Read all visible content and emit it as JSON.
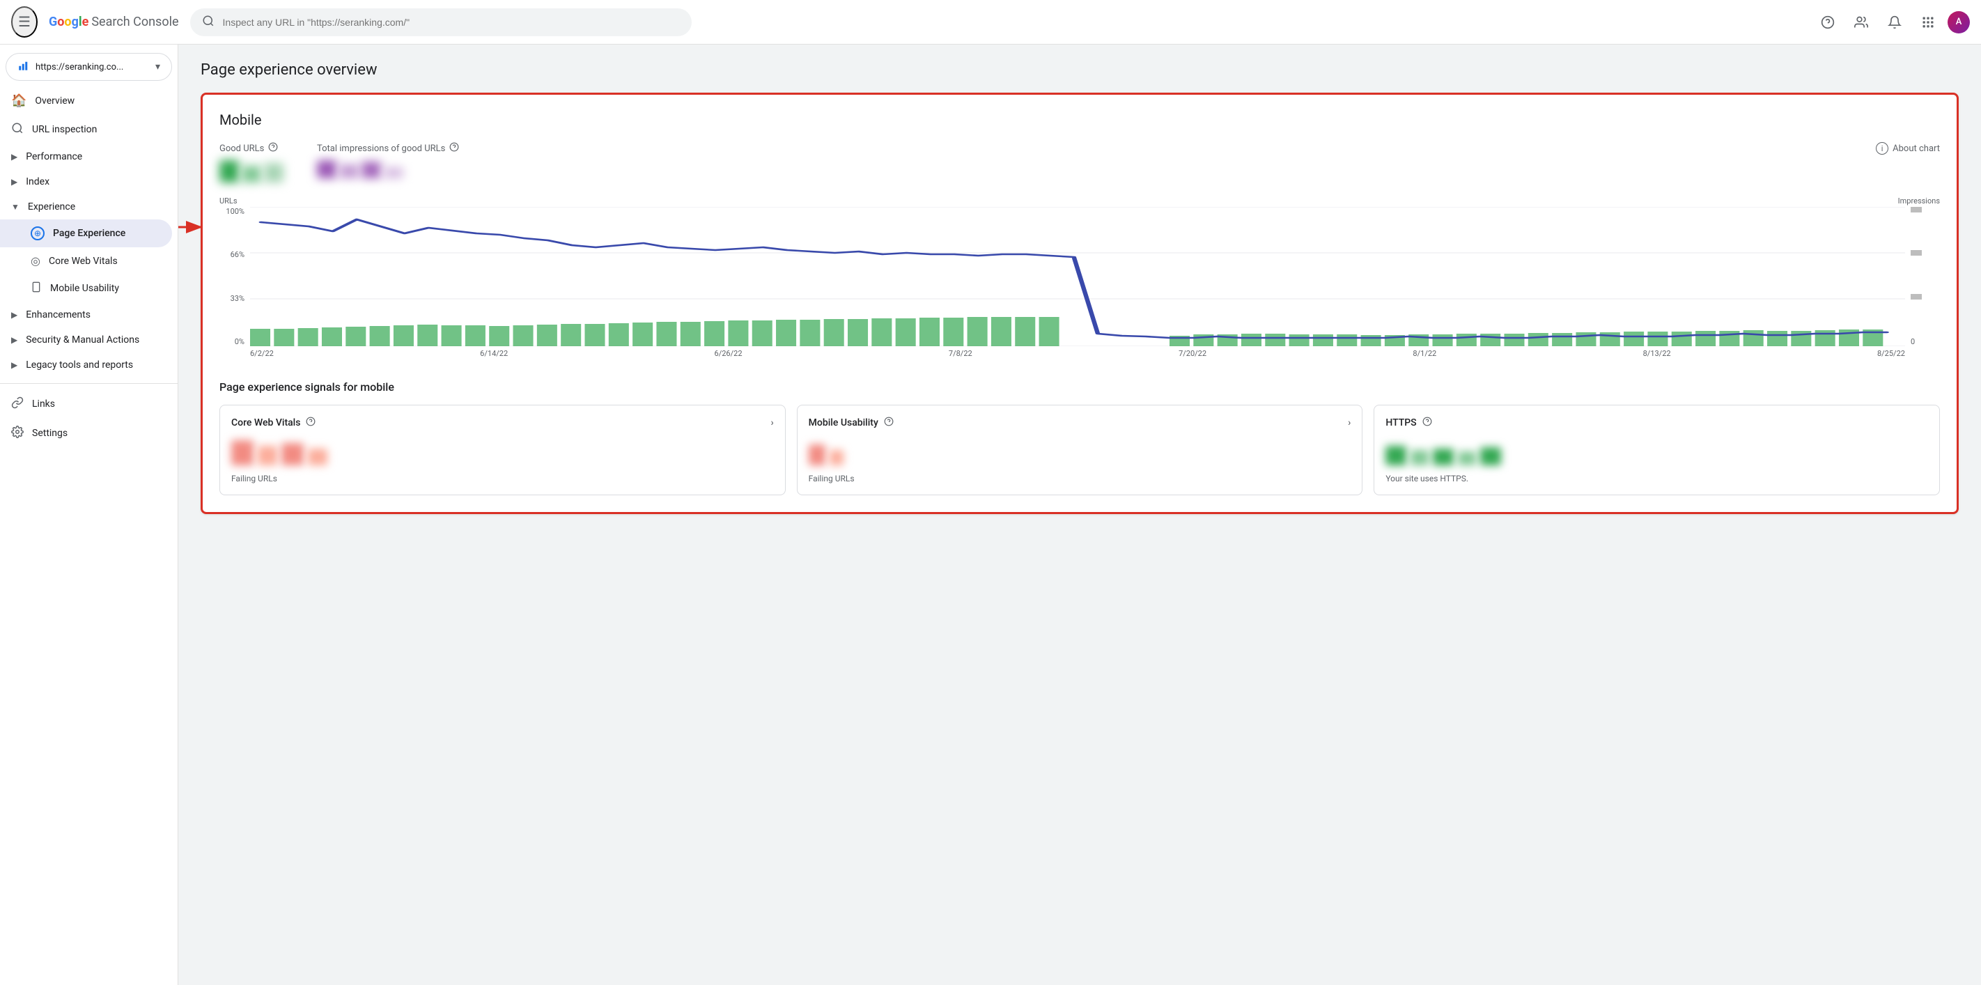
{
  "topbar": {
    "menu_label": "☰",
    "logo_letters": [
      "G",
      "o",
      "o",
      "g",
      "l",
      "e"
    ],
    "app_name": "Search Console",
    "search_placeholder": "Inspect any URL in \"https://seranking.com/\"",
    "help_icon": "?",
    "people_icon": "👤",
    "bell_icon": "🔔",
    "grid_icon": "⋮⋮⋮",
    "avatar_initial": "A"
  },
  "sidebar": {
    "site_name": "https://seranking.co...",
    "items": [
      {
        "id": "overview",
        "label": "Overview",
        "icon": "🏠",
        "type": "item"
      },
      {
        "id": "url-inspection",
        "label": "URL inspection",
        "icon": "🔍",
        "type": "item"
      },
      {
        "id": "performance",
        "label": "Performance",
        "icon": "",
        "type": "group",
        "expanded": false
      },
      {
        "id": "index",
        "label": "Index",
        "icon": "",
        "type": "group",
        "expanded": false
      },
      {
        "id": "experience",
        "label": "Experience",
        "icon": "",
        "type": "group",
        "expanded": true
      },
      {
        "id": "page-experience",
        "label": "Page Experience",
        "icon": "⊕",
        "type": "subitem",
        "active": true
      },
      {
        "id": "core-web-vitals",
        "label": "Core Web Vitals",
        "icon": "◎",
        "type": "subitem"
      },
      {
        "id": "mobile-usability",
        "label": "Mobile Usability",
        "icon": "📱",
        "type": "subitem"
      },
      {
        "id": "enhancements",
        "label": "Enhancements",
        "icon": "",
        "type": "group",
        "expanded": false
      },
      {
        "id": "security-manual",
        "label": "Security & Manual Actions",
        "icon": "",
        "type": "group",
        "expanded": false
      },
      {
        "id": "legacy-tools",
        "label": "Legacy tools and reports",
        "icon": "",
        "type": "group",
        "expanded": false
      },
      {
        "id": "links",
        "label": "Links",
        "icon": "🔗",
        "type": "item"
      },
      {
        "id": "settings",
        "label": "Settings",
        "icon": "⚙",
        "type": "item"
      }
    ]
  },
  "main": {
    "page_title": "Page experience overview",
    "card": {
      "section_title": "Mobile",
      "good_urls_label": "Good URLs",
      "total_impressions_label": "Total impressions of good URLs",
      "about_chart_label": "About chart",
      "chart": {
        "y_axis_label": "URLs",
        "y_right_label": "Impressions",
        "y_labels": [
          "100%",
          "66%",
          "33%",
          "0%"
        ],
        "y_right_labels": [
          "",
          "",
          "",
          "0"
        ],
        "x_labels": [
          "6/2/22",
          "6/14/22",
          "6/26/22",
          "7/8/22",
          "7/20/22",
          "8/1/22",
          "8/13/22",
          "8/25/22"
        ]
      },
      "signals_title": "Page experience signals for mobile",
      "signals": [
        {
          "id": "core-web-vitals",
          "label": "Core Web Vitals",
          "sub_label": "Failing URLs"
        },
        {
          "id": "mobile-usability",
          "label": "Mobile Usability",
          "sub_label": "Failing URLs"
        },
        {
          "id": "https",
          "label": "HTTPS",
          "sub_label": "Your site uses HTTPS."
        }
      ]
    }
  }
}
